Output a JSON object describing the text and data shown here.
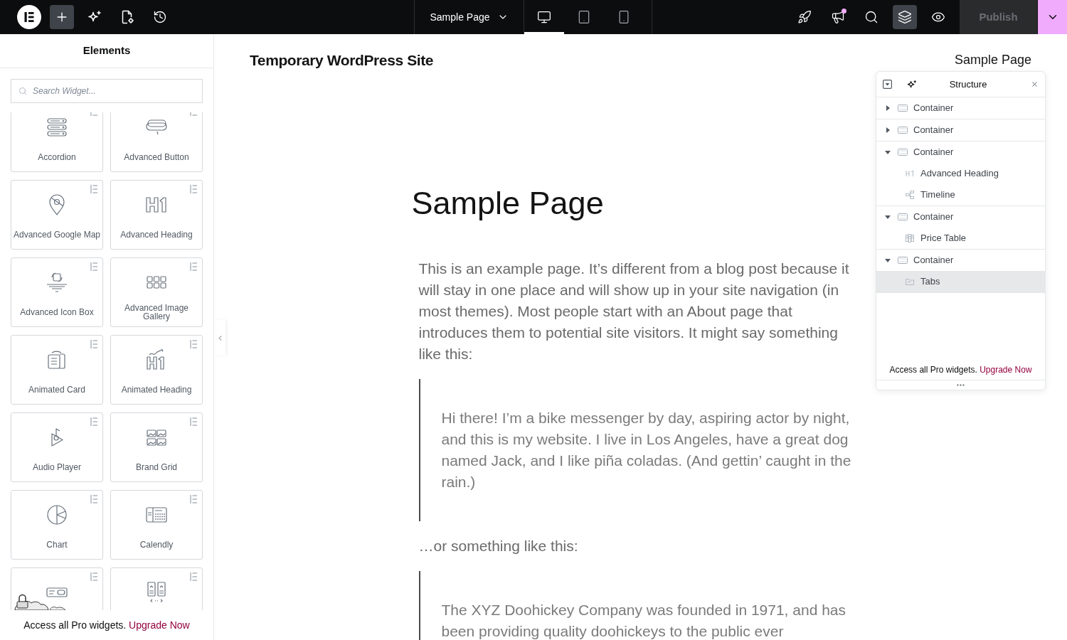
{
  "top_bar": {
    "left_tools": [
      {
        "selected": true
      },
      {
        "selected": false
      },
      {
        "selected": false
      },
      {
        "selected": false
      }
    ],
    "page_title": "Sample Page",
    "devices": [
      {
        "selected": true
      },
      {
        "selected": false
      },
      {
        "selected": false
      }
    ],
    "right_tools": [
      {
        "selected": false,
        "notification": false
      },
      {
        "selected": false,
        "notification": true
      },
      {
        "selected": false,
        "notification": false
      },
      {
        "selected": true,
        "notification": false
      },
      {
        "selected": false,
        "notification": false
      }
    ],
    "publish": {
      "label": "Publish",
      "disabled": true
    }
  },
  "elements_panel": {
    "title": "Elements",
    "search": {
      "placeholder": "Search Widget..."
    },
    "widgets": [
      {
        "label": "Accordion",
        "pro": true
      },
      {
        "label": "Advanced Button",
        "pro": true
      },
      {
        "label": "Advanced Google Map",
        "pro": true
      },
      {
        "label": "Advanced Heading",
        "pro": true
      },
      {
        "label": "Advanced Icon Box",
        "pro": true
      },
      {
        "label": "Advanced Image Gallery",
        "pro": true
      },
      {
        "label": "Animated Card",
        "pro": true
      },
      {
        "label": "Animated Heading",
        "pro": true
      },
      {
        "label": "Audio Player",
        "pro": true
      },
      {
        "label": "Brand Grid",
        "pro": true
      },
      {
        "label": "Chart",
        "pro": true
      },
      {
        "label": "Calendly",
        "pro": true
      },
      {
        "pro": true
      },
      {
        "pro": true
      }
    ],
    "promo": {
      "text": "Access all Pro widgets.",
      "link": "Upgrade Now"
    }
  },
  "canvas": {
    "site_title": "Temporary WordPress Site",
    "nav": [
      "Sample Page"
    ],
    "page_title": "Sample Page",
    "blocks": [
      {
        "kind": "paragraph",
        "text": "This is an example page. It’s different from a blog post because it will stay in one place and will show up in your site navigation (in most themes). Most people start with an About page that introduces them to potential site visitors. It might say something like this:"
      },
      {
        "kind": "quote",
        "text": "Hi there! I’m a bike messenger by day, aspiring actor by night, and this is my website. I live in Los Angeles, have a great dog named Jack, and I like piña coladas. (And gettin’ caught in the rain.)"
      },
      {
        "kind": "paragraph",
        "text": "…or something like this:"
      },
      {
        "kind": "quote",
        "text": "The XYZ Doohickey Company was founded in 1971, and has been providing quality doohickeys to the public ever"
      }
    ]
  },
  "structure_panel": {
    "title": "Structure",
    "tree": [
      {
        "label": "Container",
        "expanded": false,
        "selected": false
      },
      {
        "label": "Container",
        "expanded": false,
        "selected": false
      },
      {
        "label": "Container",
        "expanded": true,
        "selected": false,
        "children": [
          {
            "label": "Advanced Heading",
            "selected": false
          },
          {
            "label": "Timeline",
            "selected": false
          }
        ]
      },
      {
        "label": "Container",
        "expanded": true,
        "selected": false,
        "children": [
          {
            "label": "Price Table",
            "selected": false
          }
        ]
      },
      {
        "label": "Container",
        "expanded": true,
        "selected": false,
        "children": [
          {
            "label": "Tabs",
            "selected": true
          }
        ]
      }
    ],
    "promo": {
      "text": "Access all Pro widgets.",
      "link": "Upgrade Now"
    }
  }
}
